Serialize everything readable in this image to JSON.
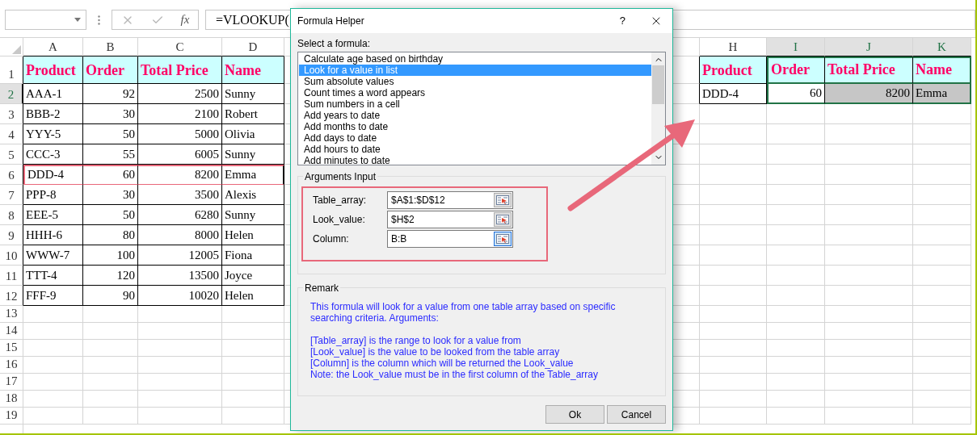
{
  "formula_bar": {
    "fx": "fx",
    "formula": "=VLOOKUP("
  },
  "sheet": {
    "left_columns": [
      "A",
      "B",
      "C",
      "D"
    ],
    "right_columns": [
      {
        "label": "H",
        "selected": false
      },
      {
        "label": "I",
        "selected": true
      },
      {
        "label": "J",
        "selected": true
      },
      {
        "label": "K",
        "selected": true
      }
    ],
    "rows": [
      {
        "number": "1",
        "selected": false
      },
      {
        "number": "2",
        "selected": true
      },
      {
        "number": "3",
        "selected": false
      },
      {
        "number": "4",
        "selected": false
      },
      {
        "number": "5",
        "selected": false
      },
      {
        "number": "6",
        "selected": false
      },
      {
        "number": "7",
        "selected": false
      },
      {
        "number": "8",
        "selected": false
      },
      {
        "number": "9",
        "selected": false
      },
      {
        "number": "10",
        "selected": false
      },
      {
        "number": "11",
        "selected": false
      },
      {
        "number": "12",
        "selected": false
      },
      {
        "number": "13",
        "selected": false
      },
      {
        "number": "14",
        "selected": false
      },
      {
        "number": "15",
        "selected": false
      },
      {
        "number": "16",
        "selected": false
      },
      {
        "number": "17",
        "selected": false
      },
      {
        "number": "18",
        "selected": false
      },
      {
        "number": "19",
        "selected": false
      }
    ]
  },
  "left_table": {
    "header": [
      {
        "label": "Product",
        "numeric": false
      },
      {
        "label": "Order",
        "numeric": true
      },
      {
        "label": "Total Price",
        "numeric": true
      },
      {
        "label": "Name",
        "numeric": false
      }
    ],
    "rows": [
      {
        "cells": [
          "AAA-1",
          "92",
          "2500",
          "Sunny"
        ],
        "highlighted": false
      },
      {
        "cells": [
          "BBB-2",
          "30",
          "2100",
          "Robert"
        ],
        "highlighted": false
      },
      {
        "cells": [
          "YYY-5",
          "50",
          "5000",
          "Olivia"
        ],
        "highlighted": false
      },
      {
        "cells": [
          "CCC-3",
          "55",
          "6005",
          "Sunny"
        ],
        "highlighted": false
      },
      {
        "cells": [
          "DDD-4",
          "60",
          "8200",
          "Emma"
        ],
        "highlighted": true
      },
      {
        "cells": [
          "PPP-8",
          "30",
          "3500",
          "Alexis"
        ],
        "highlighted": false
      },
      {
        "cells": [
          "EEE-5",
          "50",
          "6280",
          "Sunny"
        ],
        "highlighted": false
      },
      {
        "cells": [
          "HHH-6",
          "80",
          "8000",
          "Helen"
        ],
        "highlighted": false
      },
      {
        "cells": [
          "WWW-7",
          "100",
          "12005",
          "Fiona"
        ],
        "highlighted": false
      },
      {
        "cells": [
          "TTT-4",
          "120",
          "13500",
          "Joyce"
        ],
        "highlighted": false
      },
      {
        "cells": [
          "FFF-9",
          "90",
          "10020",
          "Helen"
        ],
        "highlighted": false
      }
    ]
  },
  "right_table": {
    "header": [
      {
        "label": "Product",
        "numeric": false
      },
      {
        "label": "Order",
        "numeric": true
      },
      {
        "label": "Total Price",
        "numeric": true
      },
      {
        "label": "Name",
        "numeric": false
      }
    ],
    "row": [
      {
        "text": "DDD-4",
        "selected": false,
        "active": false
      },
      {
        "text": "60",
        "selected": true,
        "active": true
      },
      {
        "text": "8200",
        "selected": true,
        "active": false
      },
      {
        "text": "Emma",
        "selected": true,
        "active": false
      }
    ]
  },
  "dialog": {
    "title": "Formula Helper",
    "help": "?",
    "select_label": "Select a formula:",
    "formulas": [
      {
        "label": "Calculate age based on birthday",
        "selected": false
      },
      {
        "label": "Look for a value in list",
        "selected": true
      },
      {
        "label": "Sum absolute values",
        "selected": false
      },
      {
        "label": "Count times a word appears",
        "selected": false
      },
      {
        "label": "Sum numbers in a cell",
        "selected": false
      },
      {
        "label": "Add years to date",
        "selected": false
      },
      {
        "label": "Add months to date",
        "selected": false
      },
      {
        "label": "Add days to date",
        "selected": false
      },
      {
        "label": "Add hours to date",
        "selected": false
      },
      {
        "label": "Add minutes to date",
        "selected": false
      }
    ],
    "arguments_title": "Arguments Input",
    "arguments_highlighted": true,
    "arguments": [
      {
        "label": "Table_array:",
        "value": "$A$1:$D$12",
        "focused": false
      },
      {
        "label": "Look_value:",
        "value": "$H$2",
        "focused": false
      },
      {
        "label": "Column:",
        "value": "B:B",
        "focused": true
      }
    ],
    "remark_title": "Remark",
    "remark_intro": "This formula will look for a value from one table array based on specific searching criteria. Arguments:",
    "remark_lines": [
      "[Table_array] is the range to look for a value from",
      "[Look_value] is the value to be looked from the table array",
      "[Column] is the column which will be returned the Look_value",
      "Note: the Look_value must be in the first column of the Table_array"
    ],
    "buttons": [
      "Ok",
      "Cancel"
    ]
  }
}
